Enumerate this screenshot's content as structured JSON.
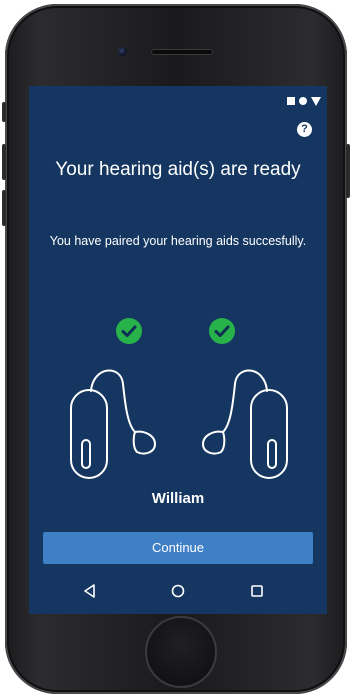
{
  "status_bar": {
    "icons": [
      "square-icon",
      "dot-icon",
      "triangle-icon"
    ]
  },
  "header": {
    "help_label": "?"
  },
  "main": {
    "title": "Your hearing aid(s) are ready",
    "subtitle": "You have paired your hearing aids succesfully.",
    "left_aid_status": "paired",
    "right_aid_status": "paired",
    "user_name": "William",
    "continue_label": "Continue"
  },
  "nav_bar": {
    "items": [
      "back-icon",
      "home-icon",
      "recents-icon"
    ]
  },
  "colors": {
    "screen_background": "#143660",
    "accent_button": "#3f7fc6",
    "check_green": "#27b34a",
    "text": "#ffffff"
  }
}
